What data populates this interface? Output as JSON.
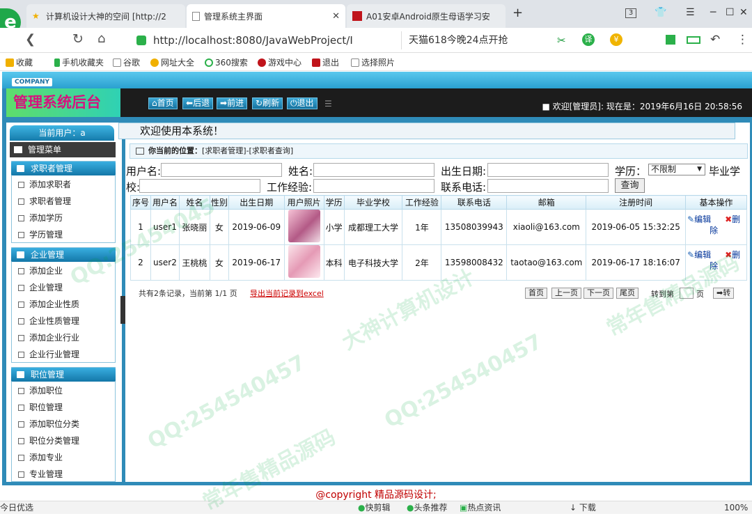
{
  "browser": {
    "tabs": [
      {
        "title": "计算机设计大神的空间 [http://2"
      },
      {
        "title": "管理系统主界面"
      },
      {
        "title": "A01安卓Android原生母语学习安"
      }
    ],
    "tab_count": "3",
    "url": "http://localhost:8080/JavaWebProject/I",
    "search_text": "天猫618今晚24点开抢",
    "bookmarks": [
      "收藏",
      "手机收藏夹",
      "谷歌",
      "网址大全",
      "360搜索",
      "游戏中心",
      "退出",
      "选择照片"
    ],
    "status": {
      "left": "今日优选",
      "items": [
        "快剪辑",
        "头条推荐",
        "热点资讯",
        "下载"
      ],
      "zoom": "100%"
    }
  },
  "app": {
    "company": "COMPANY",
    "brand": "管理系统后台",
    "nav": [
      "首页",
      "后退",
      "前进",
      "刷新",
      "退出"
    ],
    "welcome_top": "欢迎[管理员]: 现在是：2019年6月16日 20:58:56",
    "current_user": "当前用户：a",
    "menu_title": "管理菜单",
    "welcome_title": "欢迎使用本系统！",
    "position": {
      "label": "你当前的位置：",
      "value": "[求职者管理]-[求职者查询]"
    },
    "sidebar": {
      "groups": [
        {
          "title": "求职者管理",
          "items": [
            "添加求职者",
            "求职者管理",
            "添加学历",
            "学历管理"
          ]
        },
        {
          "title": "企业管理",
          "items": [
            "添加企业",
            "企业管理",
            "添加企业性质",
            "企业性质管理",
            "添加企业行业",
            "企业行业管理"
          ]
        },
        {
          "title": "职位管理",
          "items": [
            "添加职位",
            "职位管理",
            "添加职位分类",
            "职位分类管理",
            "添加专业",
            "专业管理"
          ]
        }
      ]
    },
    "filters": {
      "username": "用户名:",
      "name": "姓名:",
      "birth": "出生日期:",
      "edu": "学历：",
      "edu_value": "不限制",
      "school_a": "毕业学",
      "school_b": "校:",
      "exp": "工作经验:",
      "phone": "联系电话:",
      "query": "查询"
    },
    "table": {
      "headers": [
        "序号",
        "用户名",
        "姓名",
        "性别",
        "出生日期",
        "用户照片",
        "学历",
        "毕业学校",
        "工作经验",
        "联系电话",
        "邮箱",
        "注册时间",
        "基本操作"
      ],
      "rows": [
        {
          "no": "1",
          "user": "user1",
          "name": "张晓丽",
          "sex": "女",
          "birth": "2019-06-09",
          "edu": "小学",
          "school": "成都理工大学",
          "exp": "1年",
          "phone": "13508039943",
          "email": "xiaoli@163.com",
          "reg": "2019-06-05 15:32:25"
        },
        {
          "no": "2",
          "user": "user2",
          "name": "王桃桃",
          "sex": "女",
          "birth": "2019-06-17",
          "edu": "本科",
          "school": "电子科技大学",
          "exp": "2年",
          "phone": "13598008432",
          "email": "taotao@163.com",
          "reg": "2019-06-17 18:16:07"
        }
      ],
      "edit_a": "编辑",
      "edit_b": "辑",
      "del_a": "删",
      "del_b": "除"
    },
    "pager": {
      "summary": "共有2条记录，当前第 1/1 页",
      "export": "导出当前记录到excel",
      "buttons": [
        "首页",
        "上一页",
        "下一页",
        "尾页"
      ],
      "goto": "转到第",
      "page": "页",
      "go": "转"
    },
    "copyright": "@copyright 精品源码设计;"
  },
  "watermark": [
    "QQ:25454045",
    "大神计算机设计",
    "常年售精品源码",
    "QQ:254540457"
  ]
}
